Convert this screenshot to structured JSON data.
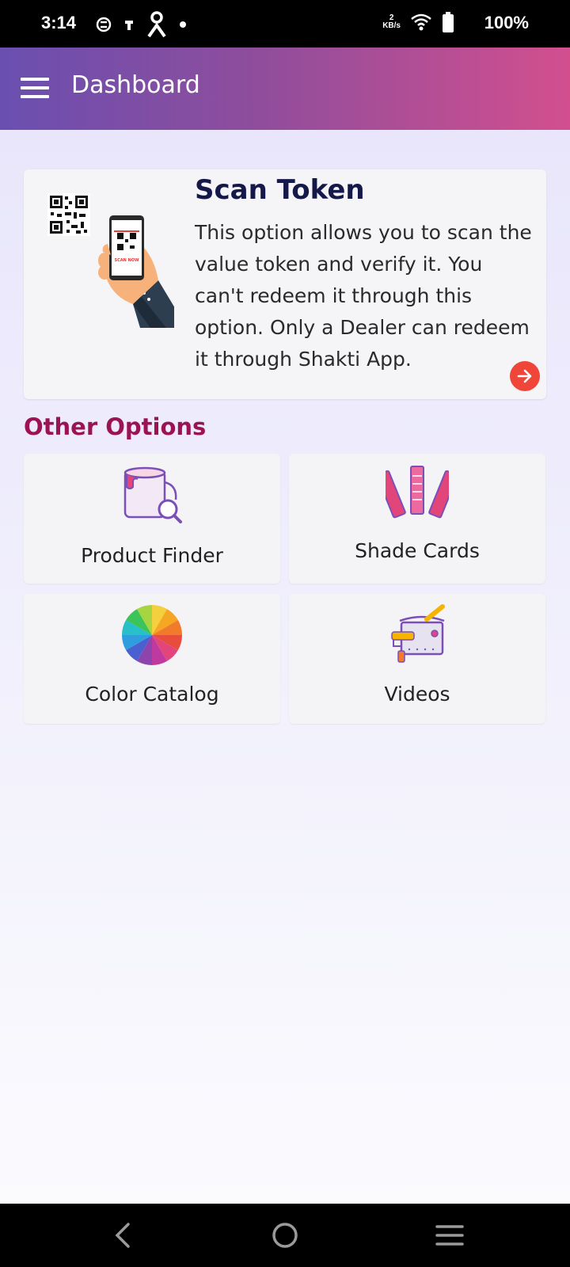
{
  "status_bar": {
    "time": "3:14",
    "net_speed_value": "2",
    "net_speed_unit": "KB/s",
    "battery": "100%",
    "icons": [
      "sim-icon",
      "usb-icon",
      "app-icon",
      "dot-icon",
      "wifi-icon",
      "battery-icon"
    ]
  },
  "app_bar": {
    "title": "Dashboard",
    "menu_icon": "hamburger-icon"
  },
  "scan_card": {
    "title": "Scan Token",
    "description": "This option allows you to scan the value token and verify it. You can't redeem it through this option. Only a Dealer can redeem it through Shakti App.",
    "illustration_label": "SCAN NOW",
    "arrow_icon": "arrow-right-icon"
  },
  "other_options": {
    "title": "Other Options",
    "tiles": [
      {
        "label": "Product Finder",
        "icon": "paint-bucket-search-icon"
      },
      {
        "label": "Shade Cards",
        "icon": "swatch-fan-icon"
      },
      {
        "label": "Color Catalog",
        "icon": "color-wheel-icon"
      },
      {
        "label": "Videos",
        "icon": "paint-roller-bucket-icon"
      }
    ]
  },
  "nav_bar": {
    "icons": [
      "back-icon",
      "home-icon",
      "recents-icon"
    ]
  },
  "colors": {
    "app_bar_start": "#6a4fb0",
    "app_bar_end": "#d24f8f",
    "section_title": "#9c1353",
    "scan_title": "#14194a",
    "arrow_button": "#f0463a"
  }
}
